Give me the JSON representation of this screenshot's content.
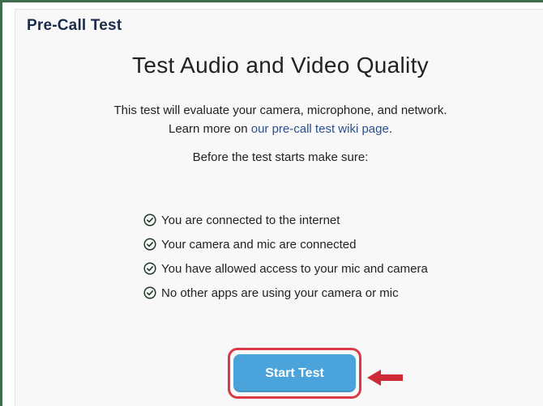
{
  "header": {
    "title": "Pre-Call Test"
  },
  "main": {
    "title": "Test Audio and Video Quality",
    "description_line1": "This test will evaluate your camera, microphone, and network.",
    "description_line2_prefix": "Learn more on ",
    "wiki_link": "our pre-call test wiki page",
    "description_line2_suffix": ".",
    "prereq_heading": "Before the test starts make sure:",
    "checklist": [
      "You are connected to the internet",
      "Your camera and mic are connected",
      "You have allowed access to your mic and camera",
      "No other apps are using your camera or mic"
    ],
    "start_button": "Start Test"
  },
  "colors": {
    "frame": "#3d6b4b",
    "header_text": "#1a2b4c",
    "link": "#2a4f8f",
    "button": "#4aa3da",
    "highlight": "#d93a45"
  },
  "icons": {
    "check": "check-circle-icon",
    "arrow": "arrow-left-icon"
  }
}
